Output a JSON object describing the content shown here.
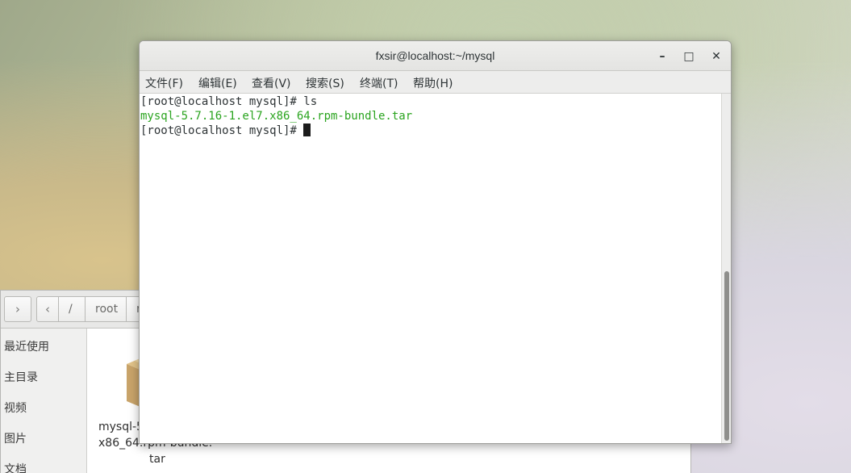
{
  "file_manager": {
    "nav": {
      "back_icon": "chevron-left-icon",
      "forward_icon": "chevron-right-icon",
      "crumb_prev_icon": "chevron-left-icon",
      "crumb_root": "/",
      "crumb_root_dir": "root",
      "crumb_truncated": "r"
    },
    "sidebar": {
      "items": [
        {
          "label": "最近使用"
        },
        {
          "label": "主目录"
        },
        {
          "label": "视频"
        },
        {
          "label": "图片"
        },
        {
          "label": "文档"
        }
      ]
    },
    "file": {
      "icon": "package-icon",
      "name_line1": "mysql-5.7.16-1.el7.",
      "name_line2": "x86_64.rpm-bundle.",
      "name_line3": "tar"
    }
  },
  "terminal": {
    "title": "fxsir@localhost:~/mysql",
    "window_buttons": {
      "minimize": "–",
      "maximize": "□",
      "close": "✕"
    },
    "menu": [
      {
        "label": "文件(F)"
      },
      {
        "label": "编辑(E)"
      },
      {
        "label": "查看(V)"
      },
      {
        "label": "搜索(S)"
      },
      {
        "label": "终端(T)"
      },
      {
        "label": "帮助(H)"
      }
    ],
    "lines": [
      {
        "text": "[root@localhost mysql]# ls"
      },
      {
        "text": "mysql-5.7.16-1.el7.x86_64.rpm-bundle.tar",
        "color": "#2aa41f"
      },
      {
        "text": "[root@localhost mysql]# "
      }
    ],
    "accent_colors": {
      "listing_green": "#2aa41f",
      "text": "#2e3436"
    }
  }
}
